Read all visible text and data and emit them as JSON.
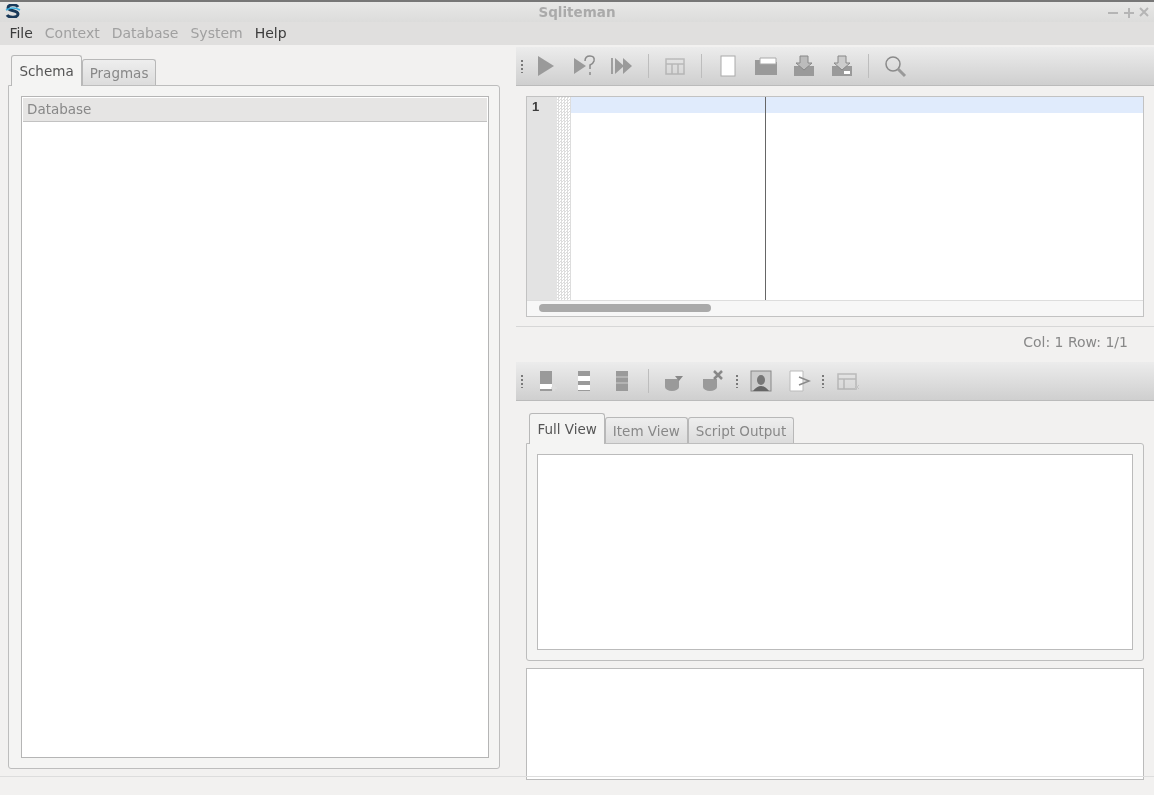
{
  "window": {
    "title": "Sqliteman"
  },
  "menu": [
    {
      "label": "File",
      "disabled": false
    },
    {
      "label": "Context",
      "disabled": true
    },
    {
      "label": "Database",
      "disabled": true
    },
    {
      "label": "System",
      "disabled": true
    },
    {
      "label": "Help",
      "disabled": false
    }
  ],
  "left_tabs": [
    {
      "label": "Schema",
      "selected": true
    },
    {
      "label": "Pragmas",
      "selected": false
    }
  ],
  "schema_tree": {
    "columns": [
      "Database"
    ]
  },
  "sql_toolbar": {
    "buttons": [
      {
        "disabled": false
      },
      {
        "disabled": false
      },
      {
        "disabled": false
      },
      {
        "disabled": true
      },
      {
        "disabled": false
      },
      {
        "disabled": false
      },
      {
        "disabled": false
      },
      {
        "disabled": false
      },
      {
        "disabled": false
      }
    ]
  },
  "editor": {
    "lines": [
      {
        "number": "1",
        "current": true
      }
    ]
  },
  "cursor_status": "Col: 1 Row: 1/1",
  "data_toolbar": {
    "buttons": [
      {
        "disabled": false
      },
      {
        "disabled": false
      },
      {
        "disabled": false
      },
      {
        "disabled": false
      },
      {
        "disabled": false
      },
      {
        "disabled": false
      },
      {
        "disabled": false
      },
      {
        "disabled": true
      }
    ]
  },
  "result_tabs": [
    {
      "label": "Full View",
      "selected": true
    },
    {
      "label": "Item View",
      "selected": false
    },
    {
      "label": "Script Output",
      "selected": false
    }
  ]
}
